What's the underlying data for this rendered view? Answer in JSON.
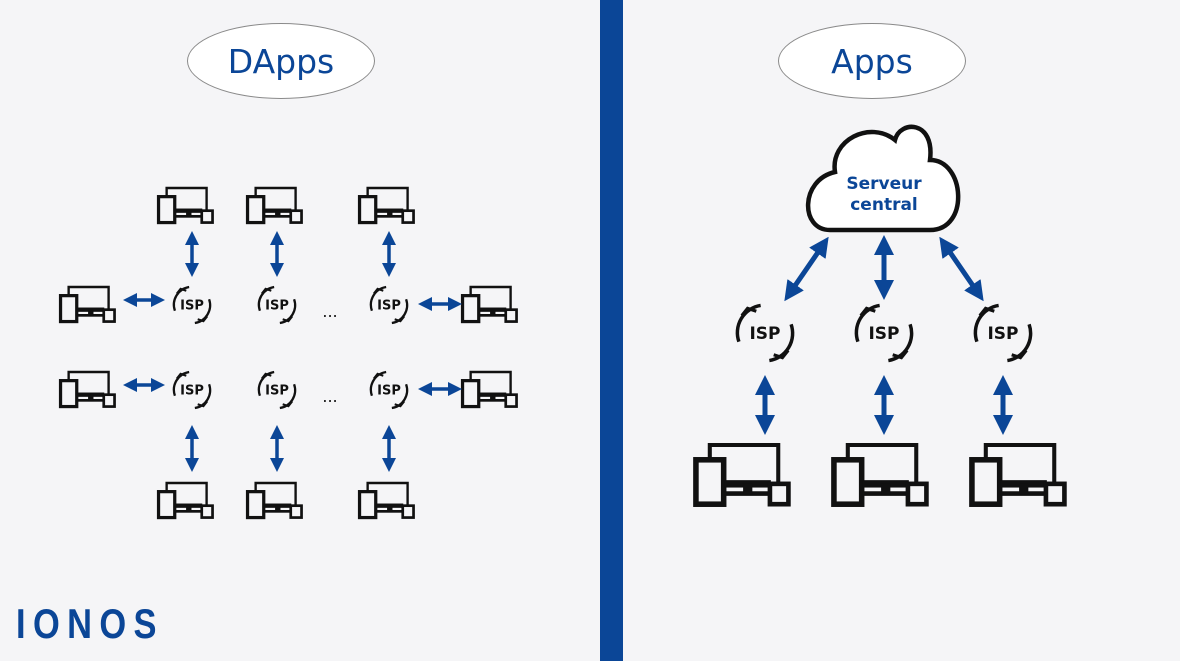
{
  "left_panel": {
    "title": "DApps",
    "node_label": "ISP",
    "ellipsis": "...",
    "rows": 2,
    "isp_per_row": 3
  },
  "right_panel": {
    "title": "Apps",
    "server_label_line1": "Serveur",
    "server_label_line2": "central",
    "node_label": "ISP",
    "isp_count": 3
  },
  "brand": {
    "logo_text": "IONOS"
  },
  "colors": {
    "accent": "#0b4697",
    "icon": "#111111",
    "background": "#f5f5f7"
  }
}
